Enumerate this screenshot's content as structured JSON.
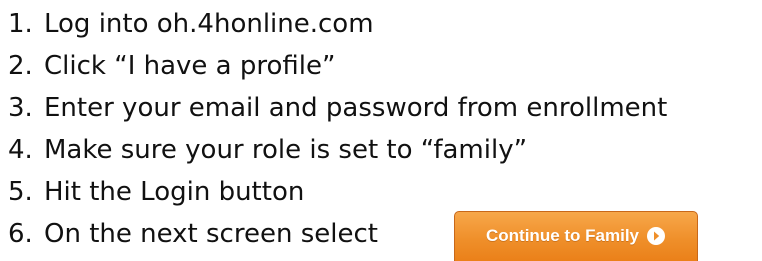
{
  "steps": [
    {
      "number": "1.",
      "text": "Log into oh.4honline.com"
    },
    {
      "number": "2.",
      "text": "Click “I have a profile”"
    },
    {
      "number": "3.",
      "text": "Enter your email and password from enrollment"
    },
    {
      "number": "4.",
      "text": "Make sure your role is set to “family”"
    },
    {
      "number": "5.",
      "text": "Hit the Login button"
    },
    {
      "number": "6.",
      "text": "On the next screen select"
    }
  ],
  "continue_button": {
    "label": "Continue to Family",
    "icon": "circle-arrow-right-icon"
  },
  "colors": {
    "button_orange": "#ef8f2a",
    "button_text": "#ffffff",
    "text": "#111111"
  }
}
